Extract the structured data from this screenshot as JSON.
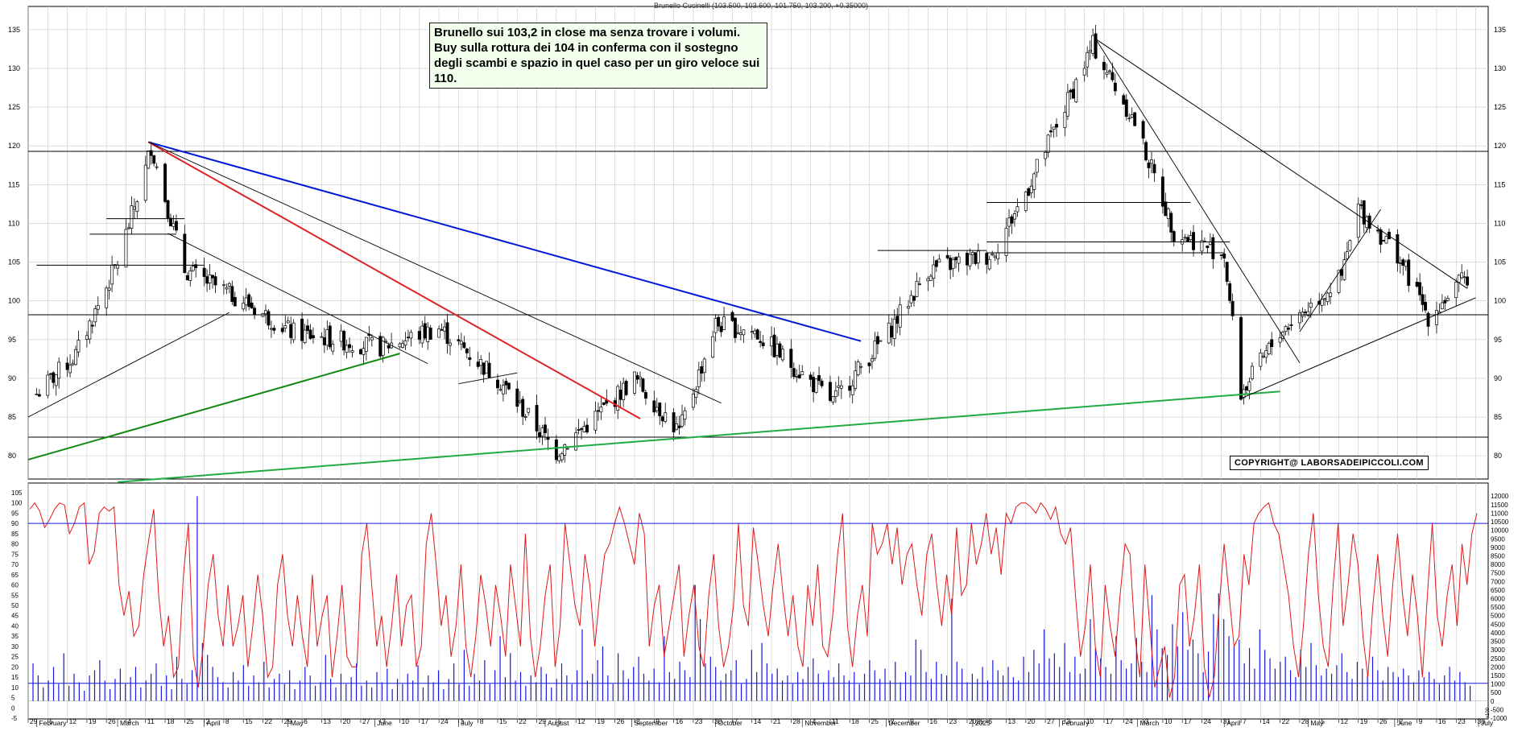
{
  "title": "Brunello Cucinelli (103.500, 103.600, 101.750, 103.200, +0.35000)",
  "annotation": {
    "text": "Brunello sui 103,2 in close ma senza trovare i volumi. Buy sulla rottura dei 104 in conferma con il sostegno degli scambi e spazio in quel caso per un giro veloce sui 110."
  },
  "copyright": "COPYRIGHT@ LABORSADEIPICCOLI.COM",
  "colors": {
    "candle": "#000000",
    "resistance_line": "#0018d8",
    "downtrend_line": "#e02020",
    "support_line_dark": "#118811",
    "support_line_light": "#22aa44",
    "oscillator": "#e01818",
    "volume": "#1818e0",
    "grid": "#c8c8c8"
  },
  "chart_data": [
    {
      "type": "candlestick",
      "title": "Brunello Cucinelli (103.500, 103.600, 101.750, 103.200, +0.35000)",
      "ylim": [
        77,
        138
      ],
      "y_ticks": [
        80,
        85,
        90,
        95,
        100,
        105,
        110,
        115,
        120,
        125,
        130,
        135
      ],
      "grid": true,
      "last_bar": {
        "open": 103.5,
        "high": 103.6,
        "low": 101.75,
        "close": 103.2,
        "change": 0.35
      },
      "horizontal_levels": [
        119.3,
        98.2,
        82.4
      ],
      "trendlines": [
        {
          "from": [
            "2024-03-12",
            120.5
          ],
          "to": [
            "2024-11-22",
            94.8
          ],
          "color": "blue"
        },
        {
          "from": [
            "2024-03-12",
            120.5
          ],
          "to": [
            "2024-09-04",
            84.8
          ],
          "color": "red"
        },
        {
          "from": [
            "2024-01-29",
            79.5
          ],
          "to": [
            "2024-06-10",
            93.2
          ],
          "color": "green"
        },
        {
          "from": [
            "2024-03-01",
            76.6
          ],
          "to": [
            "2025-04-21",
            88.3
          ],
          "color": "green"
        },
        {
          "from": [
            "2025-02-14",
            133.8
          ],
          "to": [
            "2025-06-27",
            101.6
          ],
          "color": "black"
        },
        {
          "from": [
            "2025-04-07",
            87.4
          ],
          "to": [
            "2025-06-30",
            100.4
          ],
          "color": "black"
        }
      ],
      "approx_closes": [
        [
          "2024-02-01",
          88
        ],
        [
          "2024-02-15",
          93
        ],
        [
          "2024-03-01",
          105
        ],
        [
          "2024-03-11",
          117
        ],
        [
          "2024-03-13",
          120
        ],
        [
          "2024-03-25",
          104
        ],
        [
          "2024-04-15",
          100
        ],
        [
          "2024-05-02",
          96
        ],
        [
          "2024-06-03",
          94
        ],
        [
          "2024-06-24",
          96.5
        ],
        [
          "2024-07-15",
          90
        ],
        [
          "2024-08-05",
          80.5
        ],
        [
          "2024-08-19",
          85
        ],
        [
          "2024-09-02",
          90
        ],
        [
          "2024-09-18",
          83
        ],
        [
          "2024-10-01",
          97
        ],
        [
          "2024-10-15",
          96
        ],
        [
          "2024-11-12",
          87
        ],
        [
          "2024-12-02",
          96
        ],
        [
          "2024-12-16",
          104
        ],
        [
          "2025-01-08",
          106
        ],
        [
          "2025-01-20",
          114
        ],
        [
          "2025-02-03",
          125
        ],
        [
          "2025-02-13",
          133
        ],
        [
          "2025-02-28",
          123
        ],
        [
          "2025-03-14",
          109
        ],
        [
          "2025-04-01",
          106
        ],
        [
          "2025-04-07",
          88
        ],
        [
          "2025-04-21",
          96
        ],
        [
          "2025-05-13",
          103
        ],
        [
          "2025-05-19",
          112
        ],
        [
          "2025-06-02",
          106
        ],
        [
          "2025-06-13",
          98
        ],
        [
          "2025-06-27",
          103.2
        ]
      ]
    },
    {
      "type": "line",
      "title": "",
      "series": [
        {
          "values": [
            97,
            100,
            96,
            88,
            92,
            97,
            100,
            99,
            85,
            90,
            98,
            100,
            70,
            76,
            95,
            98,
            96,
            98,
            60,
            45,
            57,
            35,
            40,
            65,
            82,
            97,
            55,
            30,
            45,
            15,
            20,
            65,
            90,
            25,
            10,
            30,
            60,
            75,
            45,
            30,
            60,
            30,
            40,
            55,
            20,
            40,
            65,
            45,
            15,
            20,
            60,
            75,
            45,
            30,
            55,
            35,
            20,
            65,
            30,
            45,
            55,
            15,
            35,
            60,
            25,
            20,
            20,
            75,
            90,
            60,
            30,
            45,
            20,
            40,
            65,
            30,
            50,
            55,
            20,
            30,
            80,
            95,
            70,
            40,
            55,
            25,
            40,
            70,
            30,
            15,
            35,
            65,
            50,
            30,
            60,
            45,
            25,
            70,
            50,
            30,
            85,
            35,
            15,
            30,
            55,
            70,
            20,
            40,
            90,
            70,
            50,
            40,
            75,
            60,
            30,
            55,
            75,
            80,
            90,
            98,
            90,
            80,
            70,
            95,
            85,
            30,
            50,
            60,
            25,
            40,
            55,
            70,
            25,
            45,
            60,
            30,
            20,
            55,
            75,
            40,
            20,
            30,
            50,
            90,
            50,
            40,
            88,
            70,
            50,
            35,
            60,
            80,
            55,
            35,
            55,
            30,
            20,
            60,
            40,
            70,
            30,
            25,
            45,
            75,
            95,
            40,
            20,
            45,
            60,
            35,
            90,
            75,
            80,
            90,
            70,
            88,
            60,
            75,
            80,
            60,
            45,
            75,
            85,
            60,
            40,
            65,
            45,
            88,
            55,
            60,
            90,
            70,
            80,
            95,
            75,
            88,
            65,
            95,
            90,
            98,
            100,
            100,
            98,
            95,
            100,
            97,
            92,
            98,
            85,
            80,
            88,
            55,
            25,
            40,
            70,
            30,
            15,
            60,
            40,
            25,
            55,
            80,
            75,
            35,
            15,
            70,
            40,
            10,
            20,
            30,
            5,
            15,
            60,
            65,
            30,
            45,
            70,
            20,
            5,
            15,
            50,
            80,
            55,
            30,
            35,
            75,
            60,
            90,
            95,
            98,
            100,
            90,
            85,
            70,
            55,
            30,
            15,
            40,
            75,
            95,
            55,
            30,
            20,
            60,
            90,
            40,
            60,
            85,
            70,
            35,
            15,
            50,
            75,
            45,
            25,
            60,
            85,
            55,
            35,
            65,
            45,
            15,
            55,
            90,
            45,
            30,
            55,
            70,
            40,
            80,
            60,
            85,
            95
          ]
        }
      ],
      "ylim": [
        -5,
        105
      ],
      "y_ticks": [
        -5,
        0,
        5,
        10,
        15,
        20,
        25,
        30,
        35,
        40,
        45,
        50,
        55,
        60,
        65,
        70,
        75,
        80,
        85,
        90,
        95,
        100,
        105
      ],
      "reference_lines": [
        90,
        12
      ]
    },
    {
      "type": "bar",
      "title": "",
      "series": [
        {
          "values": [
            2200,
            1500,
            800,
            1200,
            2000,
            1000,
            2800,
            900,
            1600,
            1100,
            600,
            1500,
            1800,
            2400,
            1200,
            700,
            1300,
            1900,
            1000,
            1400,
            2000,
            800,
            1200,
            1600,
            2200,
            900,
            1500,
            700,
            2600,
            1300,
            1000,
            1800,
            12000,
            3400,
            2700,
            2000,
            1400,
            1100,
            800,
            1700,
            1200,
            2100,
            900,
            1500,
            1100,
            2300,
            800,
            1300,
            1600,
            1000,
            1800,
            700,
            1200,
            2000,
            1500,
            900,
            1100,
            2700,
            1300,
            800,
            1600,
            1000,
            1400,
            2200,
            900,
            1200,
            800,
            1700,
            1100,
            1900,
            700,
            1300,
            1000,
            1600,
            1200,
            2100,
            800,
            1500,
            1100,
            1800,
            700,
            1300,
            2200,
            1000,
            3000,
            900,
            1600,
            1200,
            2400,
            1000,
            1800,
            3800,
            1400,
            2800,
            1200,
            1700,
            900,
            1500,
            1100,
            2000,
            1600,
            800,
            1300,
            2200,
            1500,
            1000,
            1800,
            4200,
            1200,
            1600,
            2400,
            3200,
            1500,
            1000,
            2800,
            1800,
            1300,
            2000,
            2600,
            1600,
            1200,
            1900,
            1100,
            3800,
            1700,
            1300,
            2300,
            1800,
            1400,
            6800,
            4800,
            2200,
            2600,
            2000,
            1200,
            1600,
            1800,
            2400,
            1000,
            1300,
            3000,
            1700,
            3400,
            2200,
            1600,
            1900,
            1200,
            1500,
            1000,
            1700,
            1300,
            2000,
            2500,
            1600,
            1100,
            1800,
            1400,
            2200,
            1500,
            1200,
            1700,
            1000,
            1600,
            2400,
            1800,
            1300,
            1900,
            1200,
            2300,
            1100,
            1700,
            1500,
            3600,
            3000,
            1700,
            1300,
            2300,
            1600,
            1500,
            6000,
            2300,
            1900,
            1100,
            1600,
            1300,
            2000,
            1200,
            2400,
            1800,
            1500,
            2000,
            1400,
            1200,
            2600,
            1700,
            3000,
            2200,
            4200,
            2500,
            2800,
            2000,
            3400,
            1700,
            2600,
            1600,
            1900,
            4800,
            3100,
            2500,
            2000,
            1600,
            3800,
            2400,
            1900,
            2200,
            3700,
            2300,
            1700,
            6200,
            4200,
            3100,
            2700,
            4500,
            3200,
            5200,
            3000,
            3600,
            2800,
            1700,
            2900,
            5100,
            6300,
            4800,
            3800,
            3200,
            3600,
            2200,
            3100,
            1900,
            4200,
            3000,
            2500,
            1900,
            2300,
            2600,
            1800,
            1400,
            3000,
            2000,
            3400,
            2100,
            1500,
            1900,
            1600,
            2100,
            2800,
            1700,
            1300,
            2300,
            1900,
            1500,
            2600,
            1800,
            1200,
            2000,
            1700,
            1400,
            1900,
            1500,
            1100,
            1800,
            1400,
            1700,
            1300,
            1000,
            1500,
            2000,
            1200,
            1700,
            1100,
            900
          ]
        }
      ],
      "y_ticks": [
        -1000,
        -500,
        0,
        500,
        1000,
        1500,
        2000,
        2500,
        3000,
        3500,
        4000,
        4500,
        5000,
        5500,
        6000,
        6500,
        7000,
        7500,
        8000,
        8500,
        9000,
        9500,
        10000,
        10500,
        11000,
        11500,
        12000
      ],
      "ylim": [
        -1000,
        12200
      ],
      "right_axis_unit": "x100"
    }
  ],
  "x_axis": {
    "day_ticks": [
      "29",
      "5",
      "12",
      "19",
      "26",
      "4",
      "11",
      "18",
      "25",
      "2",
      "8",
      "15",
      "22",
      "29",
      "6",
      "13",
      "20",
      "27",
      "3",
      "10",
      "17",
      "24",
      "1",
      "8",
      "15",
      "22",
      "29",
      "5",
      "12",
      "19",
      "26",
      "2",
      "9",
      "16",
      "23",
      "30",
      "7",
      "14",
      "21",
      "28",
      "4",
      "11",
      "18",
      "25",
      "2",
      "9",
      "16",
      "23",
      "2025",
      "6",
      "13",
      "20",
      "27",
      "3",
      "10",
      "17",
      "24",
      "3",
      "10",
      "17",
      "24",
      "31",
      "7",
      "14",
      "22",
      "28",
      "5",
      "12",
      "19",
      "26",
      "2",
      "9",
      "16",
      "23",
      "30",
      "7",
      "1"
    ],
    "month_labels": [
      "February",
      "March",
      "April",
      "May",
      "June",
      "July",
      "August",
      "September",
      "October",
      "November",
      "December",
      "2025",
      "February",
      "March",
      "April",
      "May",
      "June",
      "July"
    ]
  }
}
